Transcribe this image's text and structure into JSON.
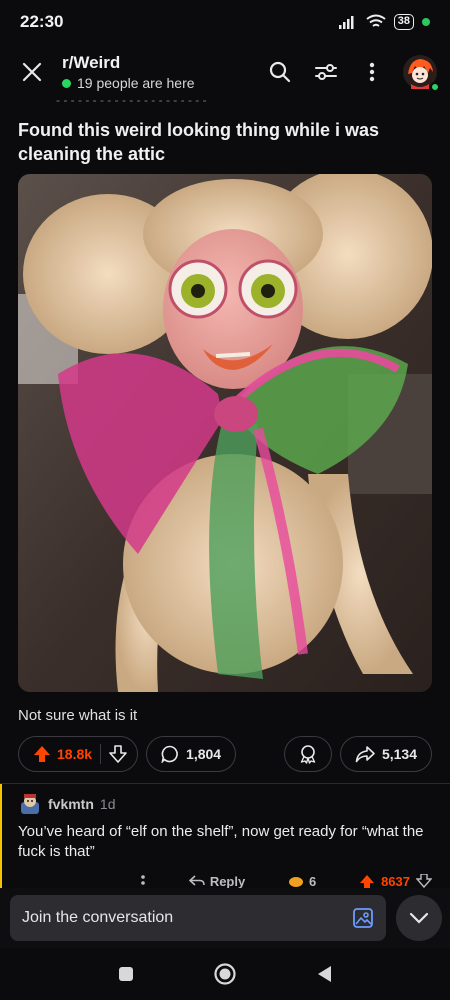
{
  "status": {
    "time": "22:30",
    "battery": "38"
  },
  "header": {
    "subreddit": "r/Weird",
    "presence": "19 people are here"
  },
  "post": {
    "title": "Found this weird looking thing while i was cleaning the attic",
    "body": "Not sure what is it",
    "upvotes": "18.8k",
    "comments": "1,804",
    "shares": "5,134"
  },
  "comment": {
    "user": "fvkmtn",
    "time": "1d",
    "text": "You’ve heard of “elf on the shelf”, now get ready for “what the fuck is that”",
    "reply_label": "Reply",
    "awards": "6",
    "votes": "8637"
  },
  "compose": {
    "placeholder": "Join the conversation"
  },
  "colors": {
    "accent": "#ff4500",
    "online": "#2bd660",
    "background": "#0b0b0d",
    "thread_line": "#f5c400"
  },
  "icons": [
    "close-icon",
    "search-icon",
    "filter-icon",
    "more-vertical-icon",
    "upvote-icon",
    "downvote-icon",
    "comment-icon",
    "award-icon",
    "share-icon",
    "image-icon",
    "chevron-down-icon"
  ]
}
